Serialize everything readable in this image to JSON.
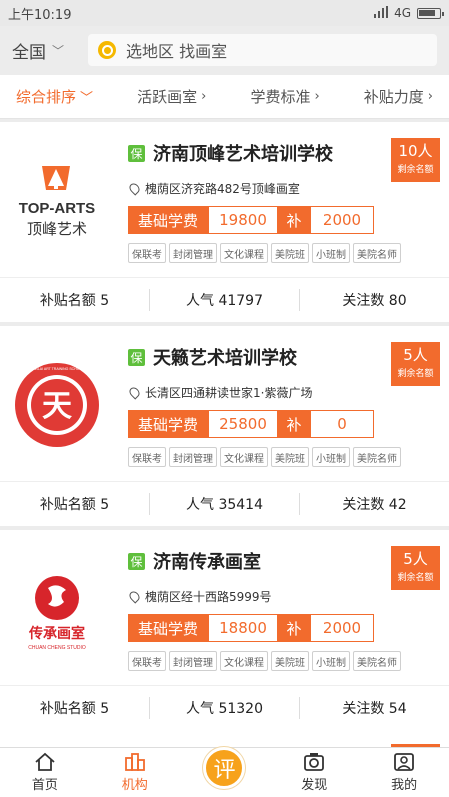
{
  "status_bar": {
    "time": "上午10:19",
    "network": "4G"
  },
  "header": {
    "region": "全国",
    "search_placeholder": "选地区 找画室"
  },
  "filters": [
    {
      "label": "综合排序",
      "arrow": "﹀"
    },
    {
      "label": "活跃画室",
      "arrow": "›"
    },
    {
      "label": "学费标准",
      "arrow": "›"
    },
    {
      "label": "补贴力度",
      "arrow": "›"
    }
  ],
  "colors": {
    "accent": "#f26b2d",
    "badge_green": "#5fbf3c",
    "center_button": "#f7a21b"
  },
  "cards": [
    {
      "badge": "保",
      "name": "济南顶峰艺术培训学校",
      "quota_num": "10人",
      "quota_sub": "剩余名额",
      "address": "槐荫区济兖路482号顶峰画室",
      "fee_label": "基础学费",
      "fee_value": "19800",
      "subsidy_label": "补",
      "subsidy_value": "2000",
      "tags": [
        "保联考",
        "封闭管理",
        "文化课程",
        "美院班",
        "小班制",
        "美院名师"
      ],
      "stat_quota": "补贴名额 5",
      "stat_popularity": "人气 41797",
      "stat_follow": "关注数 80",
      "logo_text_main": "TOP-ARTS",
      "logo_text_sub": "顶峰艺术"
    },
    {
      "badge": "保",
      "name": "天籁艺术培训学校",
      "quota_num": "5人",
      "quota_sub": "剩余名额",
      "address": "长清区四通耕读世家1·紫薇广场",
      "fee_label": "基础学费",
      "fee_value": "25800",
      "subsidy_label": "补",
      "subsidy_value": "0",
      "tags": [
        "保联考",
        "封闭管理",
        "文化课程",
        "美院班",
        "小班制",
        "美院名师"
      ],
      "stat_quota": "补贴名额 5",
      "stat_popularity": "人气 35414",
      "stat_follow": "关注数 42",
      "logo_text_main": "天",
      "logo_text_sub": "TIANLAI ART TRAINING SCHOOL"
    },
    {
      "badge": "保",
      "name": "济南传承画室",
      "quota_num": "5人",
      "quota_sub": "剩余名额",
      "address": "槐荫区经十西路5999号",
      "fee_label": "基础学费",
      "fee_value": "18800",
      "subsidy_label": "补",
      "subsidy_value": "2000",
      "tags": [
        "保联考",
        "封闭管理",
        "文化课程",
        "美院班",
        "小班制",
        "美院名师"
      ],
      "stat_quota": "补贴名额 5",
      "stat_popularity": "人气 51320",
      "stat_follow": "关注数 54",
      "logo_text_main": "传承画室",
      "logo_text_sub": "CHUAN CHENG STUDIO"
    }
  ],
  "tabbar": [
    {
      "label": "首页",
      "icon": "home-icon"
    },
    {
      "label": "机构",
      "icon": "institution-icon"
    },
    {
      "label": "评",
      "icon": "review-icon"
    },
    {
      "label": "发现",
      "icon": "discover-icon"
    },
    {
      "label": "我的",
      "icon": "profile-icon"
    }
  ]
}
